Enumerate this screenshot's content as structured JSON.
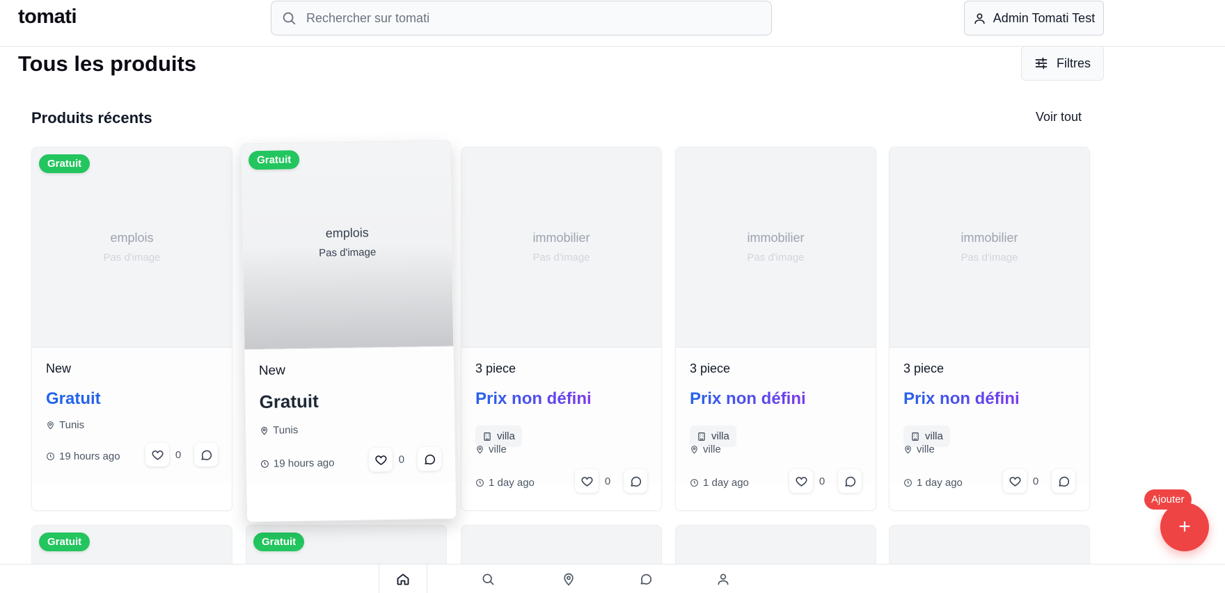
{
  "app": {
    "logo": "tomati"
  },
  "search": {
    "placeholder": "Rechercher sur tomati"
  },
  "user": {
    "name": "Admin Tomati Test"
  },
  "page": {
    "title": "Tous les produits",
    "filters_label": "Filtres"
  },
  "section": {
    "title": "Produits récents",
    "see_all": "Voir tout"
  },
  "cards": [
    {
      "badge": "Gratuit",
      "category": "emplois",
      "no_image": "Pas d'image",
      "title": "New",
      "price": "Gratuit",
      "location": "Tunis",
      "time": "19 hours ago",
      "likes": "0"
    },
    {
      "badge": "Gratuit",
      "category": "emplois",
      "no_image": "Pas d'image",
      "title": "New",
      "price": "Gratuit",
      "location": "Tunis",
      "time": "19 hours ago",
      "likes": "0"
    },
    {
      "category": "immobilier",
      "no_image": "Pas d'image",
      "title": "3 piece",
      "price": "Prix non défini",
      "tag": "villa",
      "location": "ville",
      "time": "1 day ago",
      "likes": "0"
    },
    {
      "category": "immobilier",
      "no_image": "Pas d'image",
      "title": "3 piece",
      "price": "Prix non défini",
      "tag": "villa",
      "location": "ville",
      "time": "1 day ago",
      "likes": "0"
    },
    {
      "category": "immobilier",
      "no_image": "Pas d'image",
      "title": "3 piece",
      "price": "Prix non défini",
      "tag": "villa",
      "location": "ville",
      "time": "1 day ago",
      "likes": "0"
    }
  ],
  "row2": [
    {
      "badge": "Gratuit"
    },
    {
      "badge": "Gratuit"
    }
  ],
  "fab": {
    "label": "Ajouter",
    "symbol": "+"
  },
  "icons": {
    "search": "search-icon",
    "user": "user-icon",
    "filters": "sliders-icon",
    "location": "map-pin-icon",
    "clock": "clock-icon",
    "building": "building-icon",
    "heart": "heart-icon",
    "comment": "message-circle-icon",
    "nav": [
      "home-icon",
      "search-icon",
      "map-pin-icon",
      "message-circle-icon",
      "user-icon"
    ]
  },
  "colors": {
    "accent": "#2563eb",
    "badge": "#22c55e",
    "fab": "#ef4444"
  }
}
